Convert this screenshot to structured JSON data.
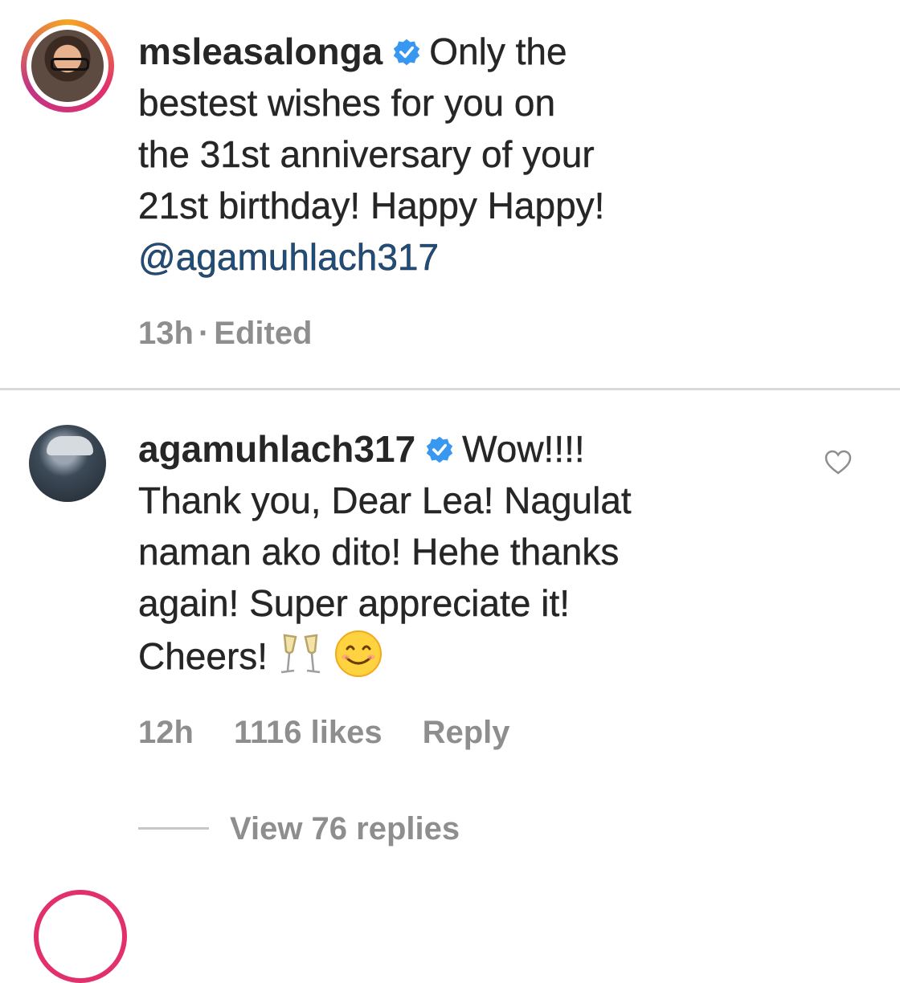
{
  "comments": [
    {
      "username": "msleasalonga",
      "text_lines": [
        "Only the",
        "bestest wishes for you on",
        "the 31st anniversary of your",
        "21st birthday! Happy Happy!"
      ],
      "mention": "@agamuhlach317",
      "time": "13h",
      "separator": "·",
      "edited": "Edited"
    },
    {
      "username": "agamuhlach317",
      "text_lines": [
        "Wow!!!!",
        "Thank you, Dear Lea! Nagulat",
        "naman ako dito! Hehe thanks",
        "again! Super appreciate it!",
        "Cheers!"
      ],
      "emojis": [
        "champagne-glasses",
        "smiling-face"
      ],
      "time": "12h",
      "likes": "1116 likes",
      "reply_label": "Reply",
      "view_replies": "View 76 replies"
    }
  ],
  "icons": {
    "verified": "verified-badge-icon",
    "like": "heart-outline-icon"
  },
  "colors": {
    "verified_blue": "#3897f0",
    "mention_blue": "#1d4e7d",
    "meta_gray": "#8e8e8e",
    "ring_pink": "#e1306c"
  }
}
